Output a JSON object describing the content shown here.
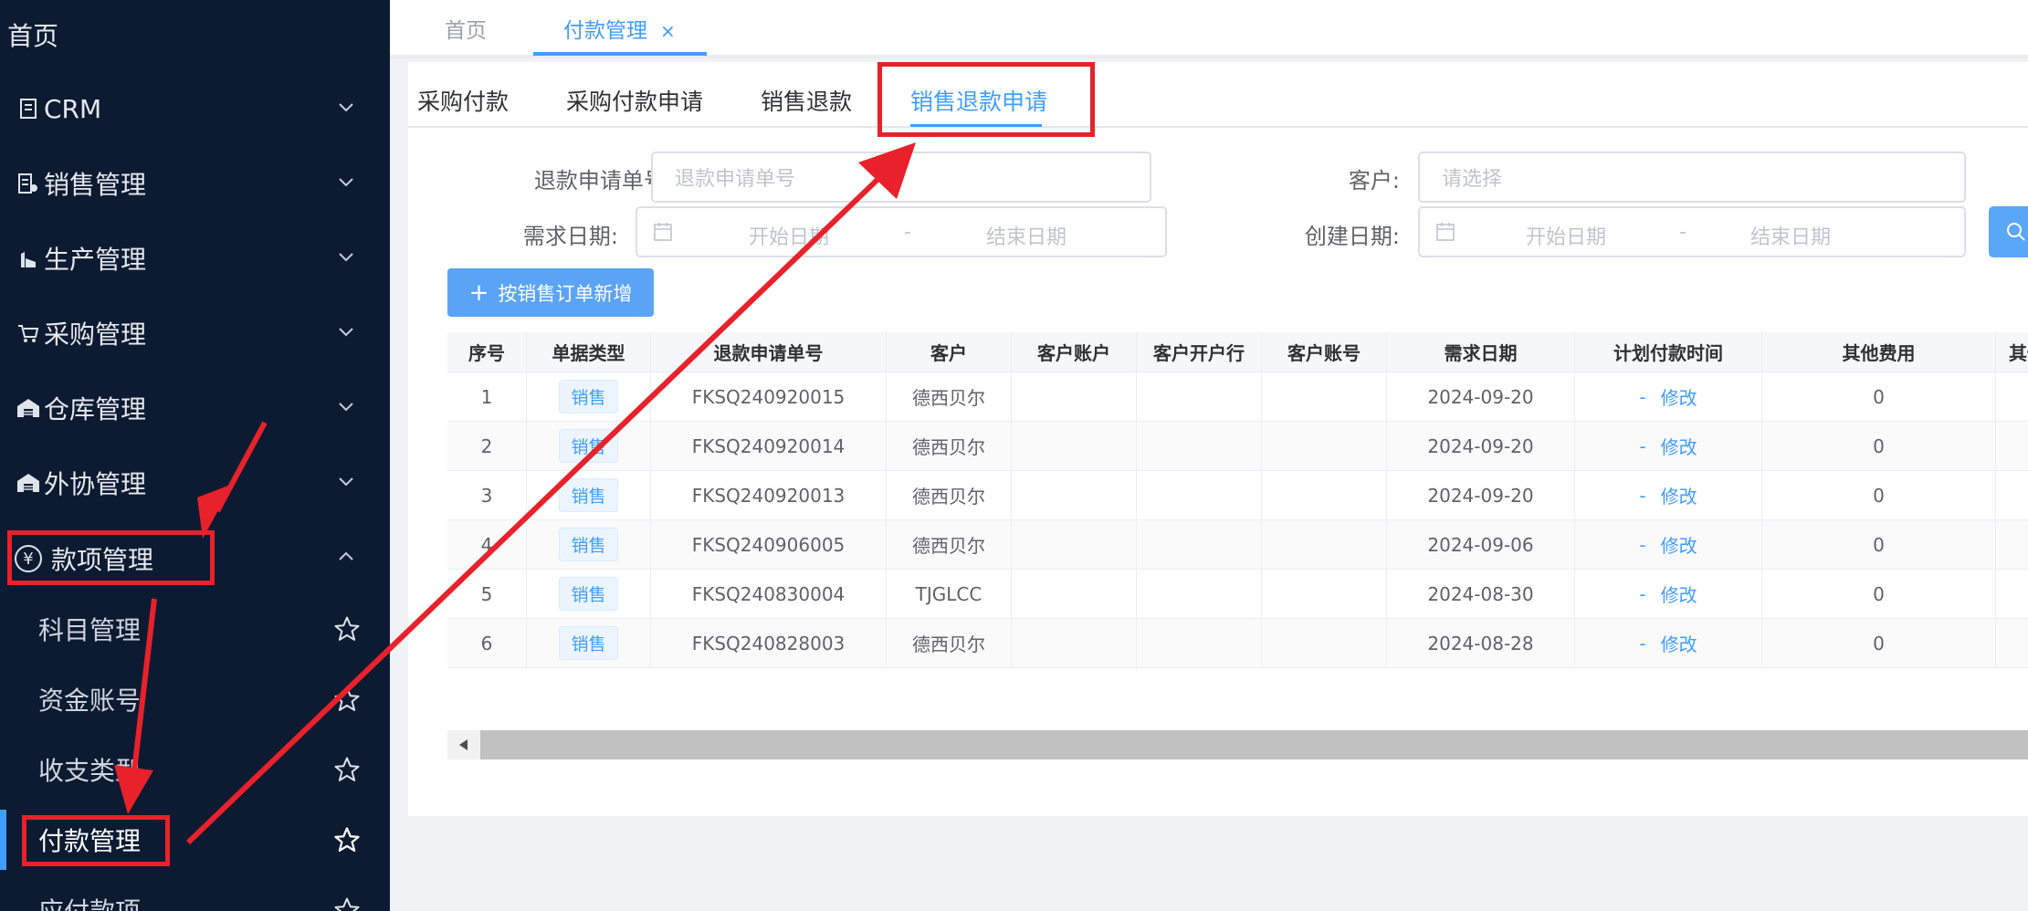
{
  "sidebar": {
    "home": "首页",
    "menus": [
      {
        "label": "CRM",
        "icon": "document-icon"
      },
      {
        "label": "销售管理",
        "icon": "sales-icon"
      },
      {
        "label": "生产管理",
        "icon": "factory-icon"
      },
      {
        "label": "采购管理",
        "icon": "cart-icon"
      },
      {
        "label": "仓库管理",
        "icon": "warehouse-icon"
      },
      {
        "label": "外协管理",
        "icon": "outsource-icon"
      },
      {
        "label": "款项管理",
        "icon": "yen-icon",
        "expanded": true
      }
    ],
    "submenu": [
      {
        "label": "科目管理"
      },
      {
        "label": "资金账号"
      },
      {
        "label": "收支类型"
      },
      {
        "label": "付款管理",
        "active": true
      },
      {
        "label": "应付款项"
      }
    ],
    "yen_symbol": "¥"
  },
  "top_tabs": [
    {
      "label": "首页"
    },
    {
      "label": "付款管理",
      "active": true,
      "close": "×"
    }
  ],
  "sub_tabs": [
    {
      "label": "采购付款"
    },
    {
      "label": "采购付款申请"
    },
    {
      "label": "销售退款"
    },
    {
      "label": "销售退款申请",
      "active": true
    }
  ],
  "filters": {
    "refund_no_label": "退款申请单号:",
    "refund_no_placeholder": "退款申请单号",
    "customer_label": "客户:",
    "customer_placeholder": "请选择",
    "demand_date_label": "需求日期:",
    "create_date_label": "创建日期:",
    "start_placeholder": "开始日期",
    "end_placeholder": "结束日期",
    "range_sep": "-"
  },
  "actions": {
    "add_label": "按销售订单新增",
    "plus": "+"
  },
  "table": {
    "columns": [
      "序号",
      "单据类型",
      "退款申请单号",
      "客户",
      "客户账户",
      "客户开户行",
      "客户账号",
      "需求日期",
      "计划付款时间",
      "其他费用",
      "其他"
    ],
    "rows": [
      {
        "no": "1",
        "type": "销售",
        "refund_no": "FKSQ240920015",
        "customer": "德西贝尔",
        "account": "",
        "bank": "",
        "account_no": "",
        "date": "2024-09-20",
        "plan_dash": "-",
        "plan_link": "修改",
        "fee": "0"
      },
      {
        "no": "2",
        "type": "销售",
        "refund_no": "FKSQ240920014",
        "customer": "德西贝尔",
        "account": "",
        "bank": "",
        "account_no": "",
        "date": "2024-09-20",
        "plan_dash": "-",
        "plan_link": "修改",
        "fee": "0"
      },
      {
        "no": "3",
        "type": "销售",
        "refund_no": "FKSQ240920013",
        "customer": "德西贝尔",
        "account": "",
        "bank": "",
        "account_no": "",
        "date": "2024-09-20",
        "plan_dash": "-",
        "plan_link": "修改",
        "fee": "0"
      },
      {
        "no": "4",
        "type": "销售",
        "refund_no": "FKSQ240906005",
        "customer": "德西贝尔",
        "account": "",
        "bank": "",
        "account_no": "",
        "date": "2024-09-06",
        "plan_dash": "-",
        "plan_link": "修改",
        "fee": "0"
      },
      {
        "no": "5",
        "type": "销售",
        "refund_no": "FKSQ240830004",
        "customer": "TJGLCC",
        "account": "",
        "bank": "",
        "account_no": "",
        "date": "2024-08-30",
        "plan_dash": "-",
        "plan_link": "修改",
        "fee": "0"
      },
      {
        "no": "6",
        "type": "销售",
        "refund_no": "FKSQ240828003",
        "customer": "德西贝尔",
        "account": "",
        "bank": "",
        "account_no": "",
        "date": "2024-08-28",
        "plan_dash": "-",
        "plan_link": "修改",
        "fee": "0"
      }
    ]
  },
  "colors": {
    "sidebar_bg": "#0d1b32",
    "accent": "#409eff",
    "annotation": "#e8212a"
  }
}
